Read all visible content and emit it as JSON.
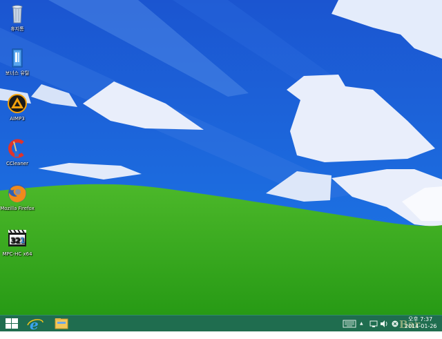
{
  "desktop": {
    "icons": [
      {
        "label": "휴지통",
        "icon": "recycle-bin-icon"
      },
      {
        "label": "보너스 유틸",
        "icon": "folder-book-icon"
      },
      {
        "label": "AIMP3",
        "icon": "aimp-icon"
      },
      {
        "label": "CCleaner",
        "icon": "ccleaner-icon"
      },
      {
        "label": "Mozilla Firefox",
        "icon": "firefox-icon"
      },
      {
        "label": "MPC-HC x64",
        "icon": "mpc-hc-icon"
      }
    ]
  },
  "taskbar": {
    "start_icon": "windows-logo-icon",
    "pinned": [
      "internet-explorer-icon",
      "file-explorer-icon"
    ],
    "tray": {
      "keyboard_icon": "keyboard-icon",
      "overflow_glyph": "▲",
      "network_icon": "network-icon",
      "volume_icon": "volume-icon",
      "action_icon": "action-center-icon",
      "time": "오후 7:37",
      "date": "2014-01-26",
      "watermark": "Bar"
    }
  },
  "colors": {
    "sky": "#1a5fd6",
    "grass": "#3aa81f",
    "taskbar": "#1f6d4f"
  }
}
